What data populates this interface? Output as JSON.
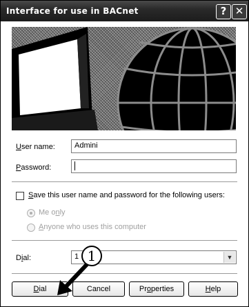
{
  "window": {
    "title": "Interface for use in BACnet",
    "help_button": "?",
    "close_button": "✕"
  },
  "form": {
    "username_label_u": "U",
    "username_label_rest": "ser name:",
    "username_value": "Admini",
    "password_label_u": "P",
    "password_label_rest": "assword:",
    "password_value": ""
  },
  "save_section": {
    "checkbox_label_u": "S",
    "checkbox_label_rest": "ave this user name and password for the following users:",
    "radio_me_only_a": "Me o",
    "radio_me_only_u": "n",
    "radio_me_only_b": "ly",
    "radio_anyone_u": "A",
    "radio_anyone_rest": "nyone who uses this computer"
  },
  "dial": {
    "label_a": "D",
    "label_u": "i",
    "label_b": "al:",
    "value": "1"
  },
  "buttons": {
    "dial_u": "D",
    "dial_rest": "ial",
    "cancel": "Cancel",
    "properties_a": "Pr",
    "properties_u": "o",
    "properties_b": "perties",
    "help_u": "H",
    "help_rest": "elp"
  },
  "annotation": {
    "step_marker": "1"
  }
}
